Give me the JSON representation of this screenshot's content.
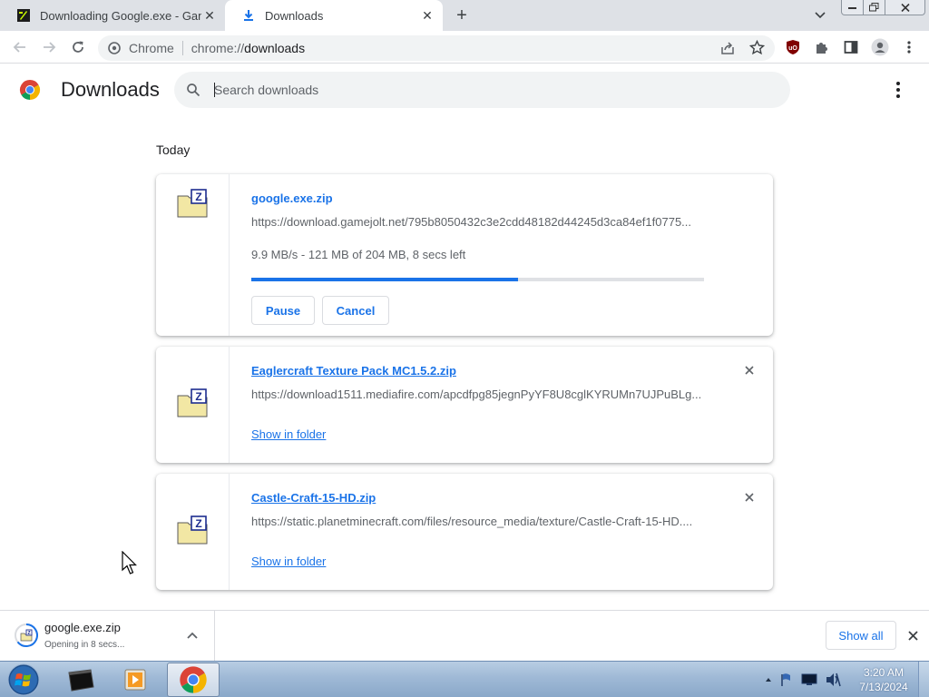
{
  "tabs": [
    {
      "title": "Downloading Google.exe - Game",
      "active": false
    },
    {
      "title": "Downloads",
      "active": true
    }
  ],
  "omnibox": {
    "site_label": "Chrome",
    "url_scheme": "chrome://",
    "url_host": "downloads"
  },
  "page": {
    "title": "Downloads",
    "search_placeholder": "Search downloads",
    "section_label": "Today"
  },
  "downloads": [
    {
      "filename": "google.exe.zip",
      "url": "https://download.gamejolt.net/795b8050432c3e2cdd48182d44245d3ca84ef1f0775...",
      "status": "9.9 MB/s - 121 MB of 204 MB, 8 secs left",
      "progress": 0.59,
      "pause_label": "Pause",
      "cancel_label": "Cancel"
    },
    {
      "filename": "Eaglercraft Texture Pack MC1.5.2.zip",
      "url": "https://download1511.mediafire.com/apcdfpg85jegnPyYF8U8cglKYRUMn7UJPuBLg...",
      "action_label": "Show in folder"
    },
    {
      "filename": "Castle-Craft-15-HD.zip",
      "url": "https://static.planetminecraft.com/files/resource_media/texture/Castle-Craft-15-HD....",
      "action_label": "Show in folder"
    }
  ],
  "shelf": {
    "filename": "google.exe.zip",
    "status": "Opening in 8 secs...",
    "show_all_label": "Show all"
  },
  "taskbar": {
    "time": "3:20 AM",
    "date": "7/13/2024"
  },
  "colors": {
    "accent": "#1a73e8",
    "tabstrip": "#dee1e6",
    "omnibox": "#f1f3f4",
    "text_secondary": "#5f6368"
  }
}
